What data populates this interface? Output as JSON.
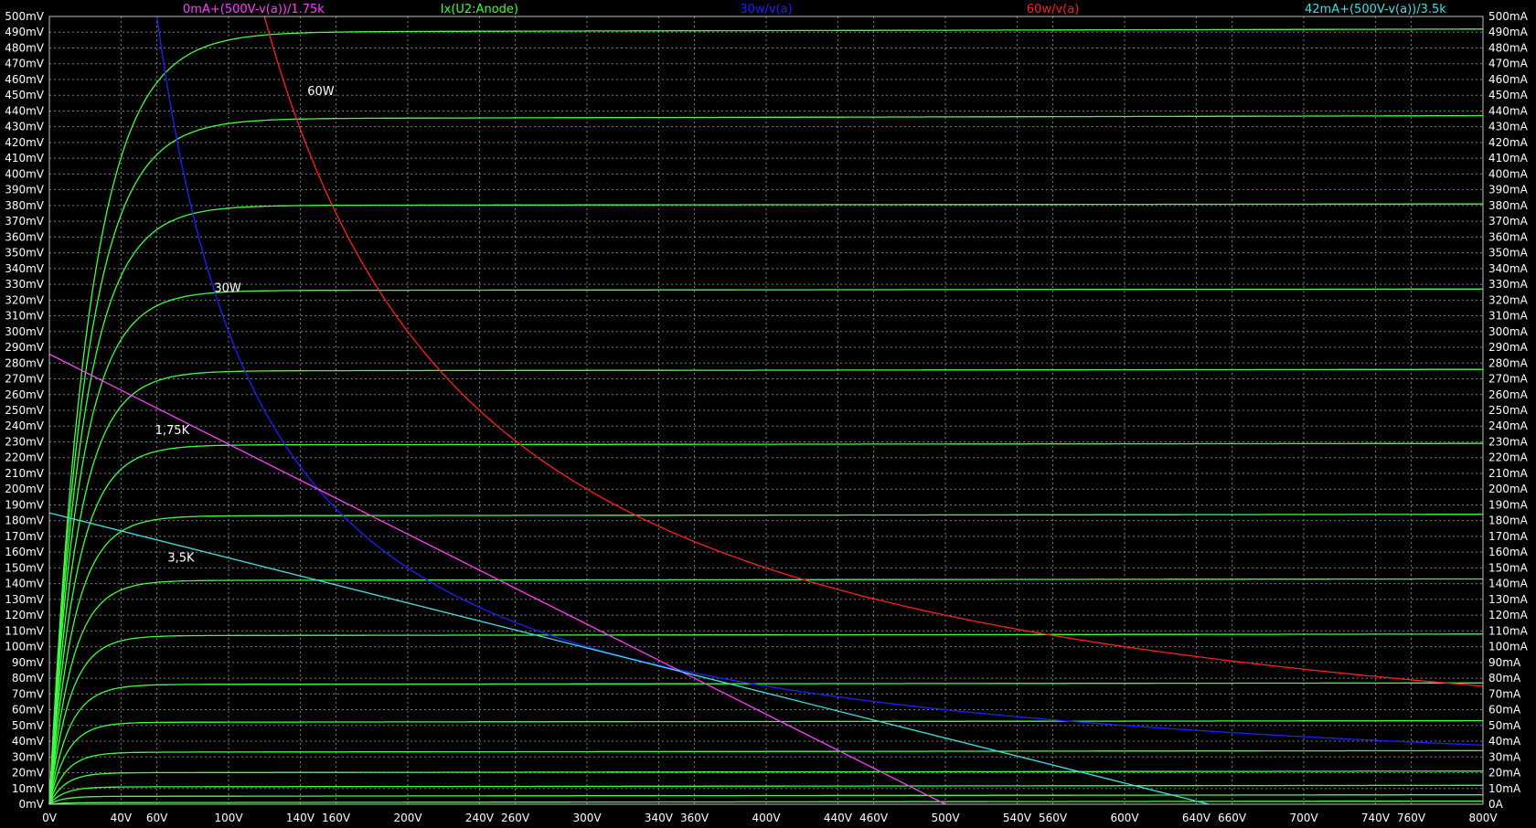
{
  "chart_data": {
    "type": "line",
    "background": "#000000",
    "grid": true,
    "grid_color": "#808080",
    "x_axis": {
      "range": [
        0,
        800
      ],
      "ticks": [
        {
          "value": 0,
          "label": "0V"
        },
        {
          "value": 40,
          "label": "40V"
        },
        {
          "value": 60,
          "label": "60V"
        },
        {
          "value": 100,
          "label": "100V"
        },
        {
          "value": 140,
          "label": "140V"
        },
        {
          "value": 160,
          "label": "160V"
        },
        {
          "value": 200,
          "label": "200V"
        },
        {
          "value": 240,
          "label": "240V"
        },
        {
          "value": 260,
          "label": "260V"
        },
        {
          "value": 300,
          "label": "300V"
        },
        {
          "value": 340,
          "label": "340V"
        },
        {
          "value": 360,
          "label": "360V"
        },
        {
          "value": 400,
          "label": "400V"
        },
        {
          "value": 440,
          "label": "440V"
        },
        {
          "value": 460,
          "label": "460V"
        },
        {
          "value": 500,
          "label": "500V"
        },
        {
          "value": 540,
          "label": "540V"
        },
        {
          "value": 560,
          "label": "560V"
        },
        {
          "value": 600,
          "label": "600V"
        },
        {
          "value": 640,
          "label": "640V"
        },
        {
          "value": 660,
          "label": "660V"
        },
        {
          "value": 700,
          "label": "700V"
        },
        {
          "value": 740,
          "label": "740V"
        },
        {
          "value": 760,
          "label": "760V"
        },
        {
          "value": 800,
          "label": "800V"
        }
      ]
    },
    "y_axis_left": {
      "range": [
        0,
        500
      ],
      "unit": "mV",
      "tick_labels": [
        "0mV",
        "10mV",
        "20mV",
        "30mV",
        "40mV",
        "50mV",
        "60mV",
        "70mV",
        "80mV",
        "90mV",
        "100mV",
        "110mV",
        "120mV",
        "130mV",
        "140mV",
        "150mV",
        "160mV",
        "170mV",
        "180mV",
        "190mV",
        "200mV",
        "210mV",
        "220mV",
        "230mV",
        "240mV",
        "250mV",
        "260mV",
        "270mV",
        "280mV",
        "290mV",
        "300mV",
        "310mV",
        "320mV",
        "330mV",
        "340mV",
        "350mV",
        "360mV",
        "370mV",
        "380mV",
        "390mV",
        "400mV",
        "410mV",
        "420mV",
        "430mV",
        "440mV",
        "450mV",
        "460mV",
        "470mV",
        "480mV",
        "490mV",
        "500mV"
      ]
    },
    "y_axis_right": {
      "range": [
        0,
        500
      ],
      "unit": "mA",
      "tick_labels": [
        "0A",
        "10mA",
        "20mA",
        "30mA",
        "40mA",
        "50mA",
        "60mA",
        "70mA",
        "80mA",
        "90mA",
        "100mA",
        "110mA",
        "120mA",
        "130mA",
        "140mA",
        "150mA",
        "160mA",
        "170mA",
        "180mA",
        "190mA",
        "200mA",
        "210mA",
        "220mA",
        "230mA",
        "240mA",
        "250mA",
        "260mA",
        "270mA",
        "280mA",
        "290mA",
        "300mA",
        "310mA",
        "320mA",
        "330mA",
        "340mA",
        "350mA",
        "360mA",
        "370mA",
        "380mA",
        "390mA",
        "400mA",
        "410mA",
        "420mA",
        "430mA",
        "440mA",
        "450mA",
        "460mA",
        "470mA",
        "480mA",
        "490mA",
        "500mA"
      ]
    },
    "trace_labels": [
      {
        "text": "0mA+(500V-v(a))/1.75k",
        "color": "#ff40ff",
        "center_x_value": 114
      },
      {
        "text": "Ix(U2:Anode)",
        "color": "#40ff40",
        "center_x_value": 240
      },
      {
        "text": "30w/v(a)",
        "color": "#2020ff",
        "center_x_value": 400
      },
      {
        "text": "60w/v(a)",
        "color": "#ff2020",
        "center_x_value": 560
      },
      {
        "text": "42mA+(500V-v(a))/3.5k",
        "color": "#40e0e0",
        "center_x_value": 740
      }
    ],
    "series": [
      {
        "name": "Ix(U2:Anode)",
        "type": "curve_family",
        "color": "#40ff40",
        "knee_volts": [
          40,
          37,
          34,
          31,
          29,
          27,
          25,
          23,
          21,
          20,
          18,
          17,
          16,
          15,
          14,
          13
        ],
        "plateau_currents_mA": [
          490,
          435,
          380,
          326,
          275,
          228,
          183,
          142,
          107,
          76,
          52,
          33,
          20,
          11,
          5,
          1
        ],
        "end_currents_mA": [
          492,
          437,
          381,
          327,
          276,
          229,
          184,
          143,
          108,
          77,
          53,
          34,
          21,
          12,
          6,
          2
        ]
      },
      {
        "name": "30w/v(a)",
        "type": "function",
        "color": "#2020ff",
        "power_W": 30,
        "x_range": [
          60,
          800
        ]
      },
      {
        "name": "60w/v(a)",
        "type": "function",
        "color": "#ff2020",
        "power_W": 60,
        "x_range": [
          120,
          800
        ]
      },
      {
        "name": "0mA+(500V-v(a))/1.75k",
        "type": "loadline",
        "color": "#ff40ff",
        "points": [
          [
            0,
            285.7
          ],
          [
            500,
            0
          ]
        ]
      },
      {
        "name": "42mA+(500V-v(a))/3.5k",
        "type": "loadline",
        "color": "#40e0e0",
        "points": [
          [
            0,
            184.9
          ],
          [
            647,
            0
          ]
        ]
      }
    ],
    "annotations": [
      {
        "text": "60W",
        "x": 144,
        "y": 450
      },
      {
        "text": "30W",
        "x": 92,
        "y": 325
      },
      {
        "text": "1,75K",
        "x": 59,
        "y": 235
      },
      {
        "text": "3,5K",
        "x": 66,
        "y": 154
      }
    ]
  }
}
